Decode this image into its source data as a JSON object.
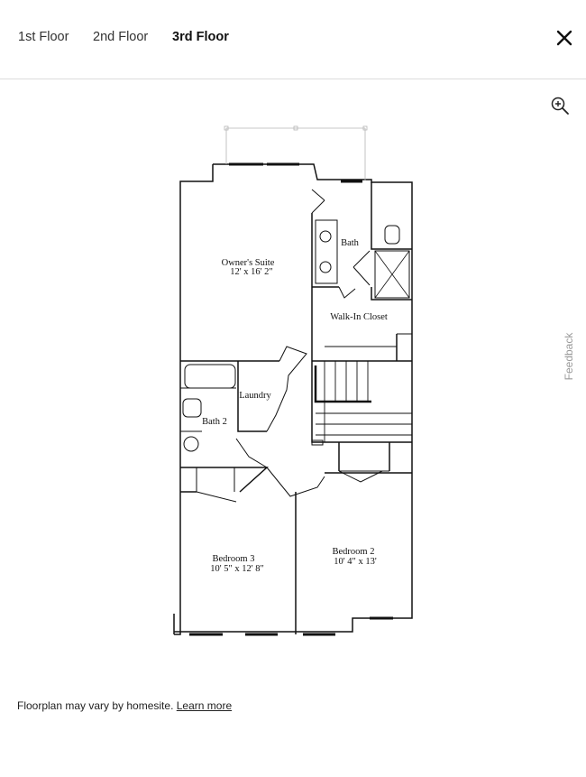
{
  "tabs": [
    {
      "label": "1st Floor",
      "active": false
    },
    {
      "label": "2nd Floor",
      "active": false
    },
    {
      "label": "3rd Floor",
      "active": true
    }
  ],
  "icons": {
    "close": "close-icon",
    "zoom": "zoom-in-icon"
  },
  "feedback_label": "Feedback",
  "floorplan": {
    "rooms": {
      "owners_suite": {
        "name": "Owner's Suite",
        "dims": "12' x 16' 2\""
      },
      "bath": {
        "name": "Bath"
      },
      "walk_in_closet": {
        "name": "Walk-In Closet"
      },
      "laundry": {
        "name": "Laundry"
      },
      "bath_2": {
        "name": "Bath 2"
      },
      "bedroom_3": {
        "name": "Bedroom 3",
        "dims": "10' 5\" x 12' 8\""
      },
      "bedroom_2": {
        "name": "Bedroom 2",
        "dims": "10' 4\" x 13'"
      }
    }
  },
  "footer": {
    "text": "Floorplan may vary by homesite.",
    "link": "Learn more"
  }
}
